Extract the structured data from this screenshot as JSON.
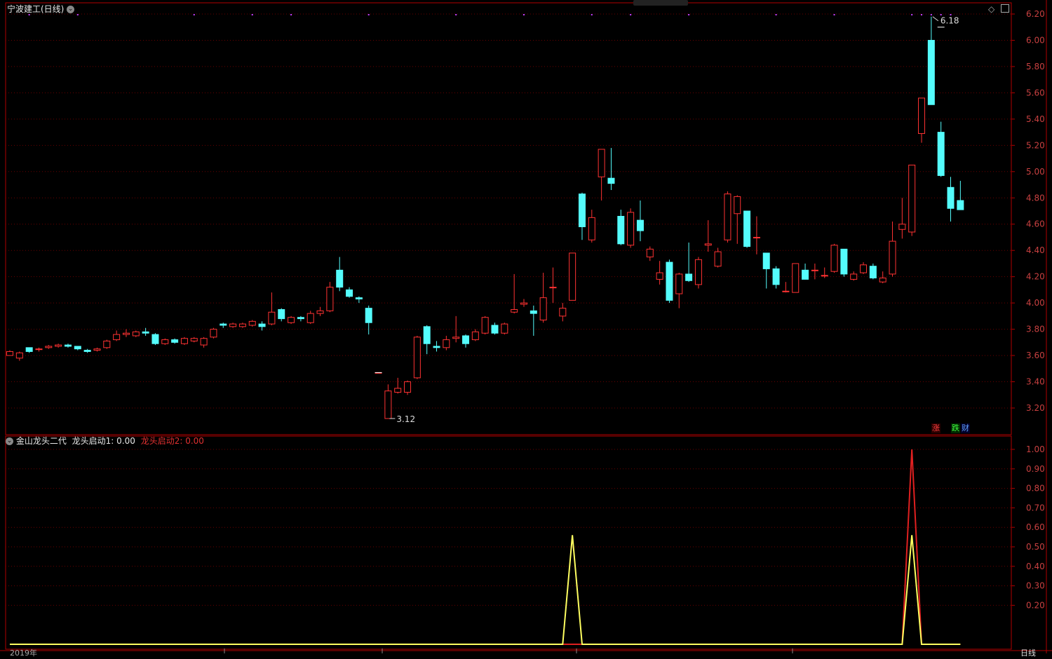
{
  "header": {
    "stock_title": "宁波建工(日线)",
    "indicator_name": "金山龙头二代",
    "ind1_label": "龙头启动1: 0.00",
    "ind2_label": "龙头启动2: 0.00",
    "tag_up": "涨",
    "tag_down": "跌",
    "tag_fin": "财",
    "bottom_left": "2019年",
    "bottom_right": "日线"
  },
  "colors": {
    "up": "#ff3232",
    "down": "#54fcfc",
    "frame": "#b00000",
    "grid": "#6a0000",
    "axis_text": "#c84040",
    "dots": "#c040ff",
    "ind1": "#ffff60",
    "ind2": "#e02020"
  },
  "chart_data": [
    {
      "type": "candlestick",
      "title": "宁波建工(日线)",
      "ylim": [
        3.05,
        6.25
      ],
      "y_ticks": [
        "6.20",
        "6.00",
        "5.80",
        "5.60",
        "5.40",
        "5.20",
        "5.00",
        "4.80",
        "4.60",
        "4.40",
        "4.20",
        "4.00",
        "3.80",
        "3.60",
        "3.40",
        "3.20"
      ],
      "annotations": {
        "high_label": "6.18",
        "low_label": "3.12"
      },
      "candles": [
        [
          3.6,
          3.63,
          3.64,
          3.6
        ],
        [
          3.58,
          3.62,
          3.63,
          3.56
        ],
        [
          3.66,
          3.63,
          3.66,
          3.62
        ],
        [
          3.65,
          3.65,
          3.66,
          3.63
        ],
        [
          3.66,
          3.67,
          3.68,
          3.65
        ],
        [
          3.67,
          3.68,
          3.69,
          3.66
        ],
        [
          3.68,
          3.67,
          3.69,
          3.66
        ],
        [
          3.67,
          3.65,
          3.67,
          3.64
        ],
        [
          3.64,
          3.63,
          3.65,
          3.62
        ],
        [
          3.64,
          3.65,
          3.66,
          3.63
        ],
        [
          3.66,
          3.71,
          3.72,
          3.65
        ],
        [
          3.72,
          3.76,
          3.79,
          3.71
        ],
        [
          3.76,
          3.77,
          3.8,
          3.74
        ],
        [
          3.75,
          3.78,
          3.79,
          3.74
        ],
        [
          3.78,
          3.77,
          3.81,
          3.75
        ],
        [
          3.76,
          3.69,
          3.77,
          3.68
        ],
        [
          3.69,
          3.72,
          3.73,
          3.68
        ],
        [
          3.72,
          3.7,
          3.73,
          3.69
        ],
        [
          3.69,
          3.73,
          3.74,
          3.68
        ],
        [
          3.71,
          3.73,
          3.74,
          3.7
        ],
        [
          3.68,
          3.73,
          3.74,
          3.66
        ],
        [
          3.74,
          3.8,
          3.81,
          3.73
        ],
        [
          3.84,
          3.83,
          3.85,
          3.81
        ],
        [
          3.82,
          3.84,
          3.85,
          3.81
        ],
        [
          3.82,
          3.84,
          3.85,
          3.81
        ],
        [
          3.83,
          3.86,
          3.87,
          3.82
        ],
        [
          3.84,
          3.82,
          3.86,
          3.79
        ],
        [
          3.84,
          3.93,
          4.08,
          3.83
        ],
        [
          3.95,
          3.88,
          3.96,
          3.86
        ],
        [
          3.85,
          3.89,
          3.9,
          3.84
        ],
        [
          3.89,
          3.88,
          3.9,
          3.86
        ],
        [
          3.85,
          3.92,
          3.94,
          3.84
        ],
        [
          3.92,
          3.94,
          3.97,
          3.9
        ],
        [
          3.94,
          4.12,
          4.16,
          3.93
        ],
        [
          4.25,
          4.12,
          4.35,
          4.09
        ],
        [
          4.1,
          4.05,
          4.12,
          4.04
        ],
        [
          4.04,
          4.03,
          4.05,
          4.0
        ],
        [
          3.96,
          3.85,
          3.98,
          3.76
        ],
        [
          3.47,
          3.47,
          3.47,
          3.47
        ],
        [
          3.12,
          3.33,
          3.38,
          3.12
        ],
        [
          3.32,
          3.35,
          3.43,
          3.31
        ],
        [
          3.32,
          3.4,
          3.41,
          3.3
        ],
        [
          3.43,
          3.74,
          3.75,
          3.42
        ],
        [
          3.82,
          3.69,
          3.83,
          3.61
        ],
        [
          3.67,
          3.66,
          3.71,
          3.63
        ],
        [
          3.66,
          3.72,
          3.75,
          3.64
        ],
        [
          3.73,
          3.74,
          3.9,
          3.7
        ],
        [
          3.75,
          3.69,
          3.76,
          3.66
        ],
        [
          3.72,
          3.78,
          3.8,
          3.71
        ],
        [
          3.77,
          3.89,
          3.9,
          3.76
        ],
        [
          3.83,
          3.77,
          3.85,
          3.76
        ],
        [
          3.77,
          3.84,
          3.85,
          3.76
        ],
        [
          3.93,
          3.95,
          4.22,
          3.92
        ],
        [
          3.99,
          4.0,
          4.03,
          3.97
        ],
        [
          3.94,
          3.92,
          3.98,
          3.75
        ],
        [
          3.87,
          4.04,
          4.23,
          3.85
        ],
        [
          4.12,
          4.12,
          4.27,
          4.0
        ],
        [
          3.9,
          3.96,
          4.0,
          3.86
        ],
        [
          4.02,
          4.38,
          4.38,
          4.02
        ],
        [
          4.83,
          4.58,
          4.84,
          4.48
        ],
        [
          4.48,
          4.65,
          4.71,
          4.46
        ],
        [
          4.96,
          5.17,
          5.17,
          4.78
        ],
        [
          4.95,
          4.91,
          5.18,
          4.86
        ],
        [
          4.66,
          4.45,
          4.71,
          4.44
        ],
        [
          4.44,
          4.69,
          4.72,
          4.42
        ],
        [
          4.63,
          4.55,
          4.78,
          4.47
        ],
        [
          4.35,
          4.41,
          4.43,
          4.32
        ],
        [
          4.18,
          4.23,
          4.32,
          4.14
        ],
        [
          4.31,
          4.02,
          4.33,
          4.0
        ],
        [
          4.07,
          4.22,
          4.23,
          3.96
        ],
        [
          4.22,
          4.17,
          4.46,
          4.16
        ],
        [
          4.14,
          4.33,
          4.35,
          4.11
        ],
        [
          4.44,
          4.45,
          4.63,
          4.39
        ],
        [
          4.28,
          4.39,
          4.42,
          4.27
        ],
        [
          4.48,
          4.83,
          4.85,
          4.46
        ],
        [
          4.68,
          4.81,
          4.82,
          4.45
        ],
        [
          4.7,
          4.43,
          4.7,
          4.42
        ],
        [
          4.5,
          4.5,
          4.66,
          4.37
        ],
        [
          4.38,
          4.26,
          4.38,
          4.11
        ],
        [
          4.26,
          4.14,
          4.28,
          4.11
        ],
        [
          4.09,
          4.09,
          4.16,
          4.08
        ],
        [
          4.08,
          4.3,
          4.3,
          4.08
        ],
        [
          4.25,
          4.18,
          4.3,
          4.18
        ],
        [
          4.25,
          4.25,
          4.3,
          4.18
        ],
        [
          4.21,
          4.21,
          4.27,
          4.19
        ],
        [
          4.24,
          4.44,
          4.45,
          4.23
        ],
        [
          4.41,
          4.22,
          4.41,
          4.2
        ],
        [
          4.18,
          4.22,
          4.24,
          4.17
        ],
        [
          4.23,
          4.29,
          4.31,
          4.22
        ],
        [
          4.28,
          4.19,
          4.3,
          4.18
        ],
        [
          4.16,
          4.19,
          4.24,
          4.15
        ],
        [
          4.22,
          4.47,
          4.62,
          4.2
        ],
        [
          4.56,
          4.6,
          4.8,
          4.49
        ],
        [
          4.54,
          5.05,
          5.05,
          4.51
        ],
        [
          5.29,
          5.56,
          5.56,
          5.22
        ],
        [
          6.0,
          5.51,
          6.18,
          5.51
        ],
        [
          5.3,
          4.97,
          5.38,
          4.96
        ],
        [
          4.88,
          4.72,
          4.96,
          4.62
        ],
        [
          4.78,
          4.71,
          4.93,
          4.71
        ]
      ],
      "marker_dashes": [
        {
          "index": 38,
          "value": 3.47
        },
        {
          "index": 96,
          "value": 6.1
        }
      ]
    },
    {
      "type": "line",
      "title": "金山龙头二代",
      "ylim": [
        0,
        1.08
      ],
      "y_ticks": [
        "1.00",
        "0.90",
        "0.80",
        "0.70",
        "0.60",
        "0.50",
        "0.40",
        "0.30",
        "0.20"
      ],
      "series": [
        {
          "name": "龙头启动1",
          "color": "#ffff60",
          "values": [
            0,
            0,
            0,
            0,
            0,
            0,
            0,
            0,
            0,
            0,
            0,
            0,
            0,
            0,
            0,
            0,
            0,
            0,
            0,
            0,
            0,
            0,
            0,
            0,
            0,
            0,
            0,
            0,
            0,
            0,
            0,
            0,
            0,
            0,
            0,
            0,
            0,
            0,
            0,
            0,
            0,
            0,
            0,
            0,
            0,
            0,
            0,
            0,
            0,
            0,
            0,
            0,
            0,
            0,
            0,
            0,
            0,
            0,
            0.56,
            0,
            0,
            0,
            0,
            0,
            0,
            0,
            0,
            0,
            0,
            0,
            0,
            0,
            0,
            0,
            0,
            0,
            0,
            0,
            0,
            0,
            0,
            0,
            0,
            0,
            0,
            0,
            0,
            0,
            0,
            0,
            0,
            0,
            0,
            0.56,
            0,
            0,
            0,
            0,
            0
          ]
        },
        {
          "name": "龙头启动2",
          "color": "#e02020",
          "values": [
            0,
            0,
            0,
            0,
            0,
            0,
            0,
            0,
            0,
            0,
            0,
            0,
            0,
            0,
            0,
            0,
            0,
            0,
            0,
            0,
            0,
            0,
            0,
            0,
            0,
            0,
            0,
            0,
            0,
            0,
            0,
            0,
            0,
            0,
            0,
            0,
            0,
            0,
            0,
            0,
            0,
            0,
            0,
            0,
            0,
            0,
            0,
            0,
            0,
            0,
            0,
            0,
            0,
            0,
            0,
            0,
            0,
            0,
            0,
            0,
            0,
            0,
            0,
            0,
            0,
            0,
            0,
            0,
            0,
            0,
            0,
            0,
            0,
            0,
            0,
            0,
            0,
            0,
            0,
            0,
            0,
            0,
            0,
            0,
            0,
            0,
            0,
            0,
            0,
            0,
            0,
            0,
            0,
            1.0,
            0,
            0,
            0,
            0,
            0
          ]
        }
      ]
    }
  ]
}
